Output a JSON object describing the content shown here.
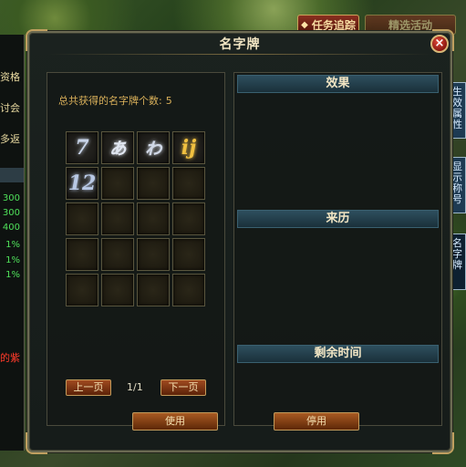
{
  "top_buttons": {
    "quest_track": "任务追踪",
    "second": "精选活动"
  },
  "dialog": {
    "title": "名字牌",
    "close_symbol": "×",
    "count_label": "总共获得的名字牌个数:",
    "count_value": "5",
    "pager": {
      "prev": "上一页",
      "page": "1/1",
      "next": "下一页"
    },
    "sections": {
      "effect": "效果",
      "origin": "来历",
      "time_left": "剩余时间"
    },
    "buttons": {
      "use": "使用",
      "stop": "停用"
    }
  },
  "name_cards": [
    {
      "glyph": "7",
      "color": "#c8d4e8"
    },
    {
      "glyph": "ぁ",
      "color": "#e0e6f0"
    },
    {
      "glyph": "ゎ",
      "color": "#d0d8e6"
    },
    {
      "glyph": "ĳ",
      "color": "#f0c040"
    },
    {
      "glyph": "12",
      "color": "#b8c8e4"
    }
  ],
  "grid": {
    "columns": 4,
    "rows": 5
  },
  "left_panel": {
    "texts": [
      "资格",
      "讨会",
      "多返"
    ],
    "numbers": [
      "300",
      "300",
      "400",
      "1%",
      "1%",
      "1%"
    ],
    "red_text": "的紫"
  },
  "right_tabs": [
    "生效属性",
    "显示称号",
    "名字牌"
  ]
}
